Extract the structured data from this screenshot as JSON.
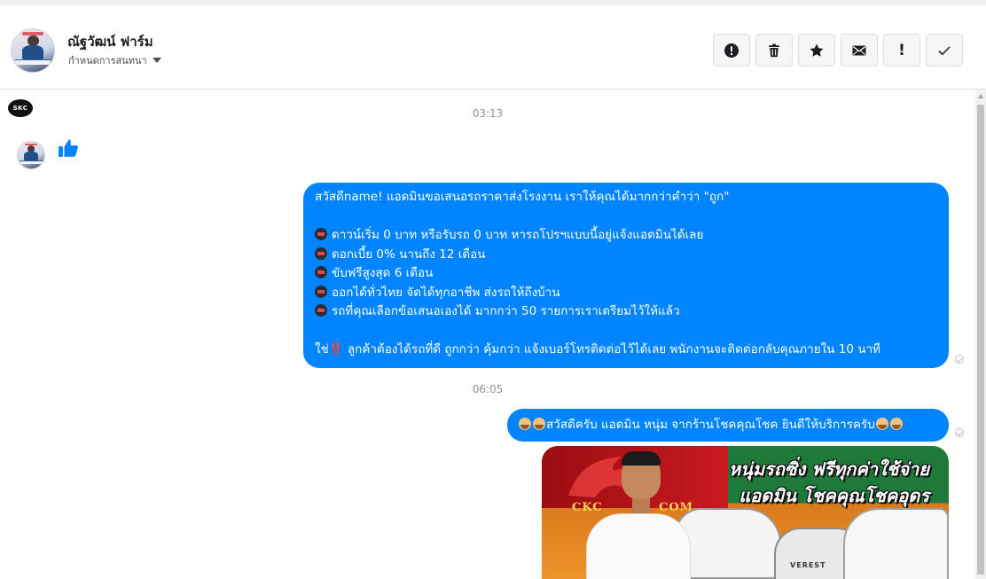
{
  "header": {
    "contact_name": "ณัฐวัฒน์ ฟาร์ม",
    "assign_label": "กำหนดการสนทนา"
  },
  "actions": {
    "spam_label": "!",
    "important": "!"
  },
  "conversation": {
    "page_logo_text": "SKC",
    "timestamp_1": "03:13",
    "timestamp_2": "06:05",
    "message_1": {
      "greeting": "สวัสดีname! แอดมินขอเสนอรถราคาส่งโรงงาน เราให้คุณได้มากกว่าคำว่า \"ถูก\"",
      "bullets": [
        "ดาวน์เริ่ม 0 บาท หรือรับรถ 0 บาท หารถโปรฯแบบนี้อยู่แจ้งแอดมินได้เลย",
        "ดอกเบี้ย 0% นานถึง 12 เดือน",
        "ขับฟรีสูงสุด 6 เดือน",
        "ออกได้ทั่วไทย จัดได้ทุกอาชีพ ส่งรถให้ถึงบ้าน",
        "รถที่คุณเลือกข้อเสนอเองได้ มากกว่า 50 รายการเราเตรียมไว้ให้แล้ว"
      ],
      "closing_prefix": "ใช่",
      "closing_emphasis": "‼️",
      "closing_text": " ลูกค้าต้องได้รถที่ดี ถูกกว่า คุ้มกว่า แจ้งเบอร์โทรติดต่อไว้ได้เลย พนักงานจะติดต่อกลับคุณภายใน 10 นาที"
    },
    "message_2": {
      "text": "สวัสดีครับ แอดมิน หนุ่ม จากร้านโชคคุณโชค ยินดีให้บริการครับ"
    },
    "image": {
      "brand": "CKC",
      "site": "COM",
      "headline_1": "หนุ่มรถซิ่ง ฟรีทุกค่าใช้จ่าย",
      "headline_2": "แอดมิน โชคคุณโชคอุดร",
      "car_badge": "VEREST"
    }
  },
  "colors": {
    "bubble": "#0084ff",
    "timestamp": "#90949c",
    "header_border": "#dadde1"
  }
}
